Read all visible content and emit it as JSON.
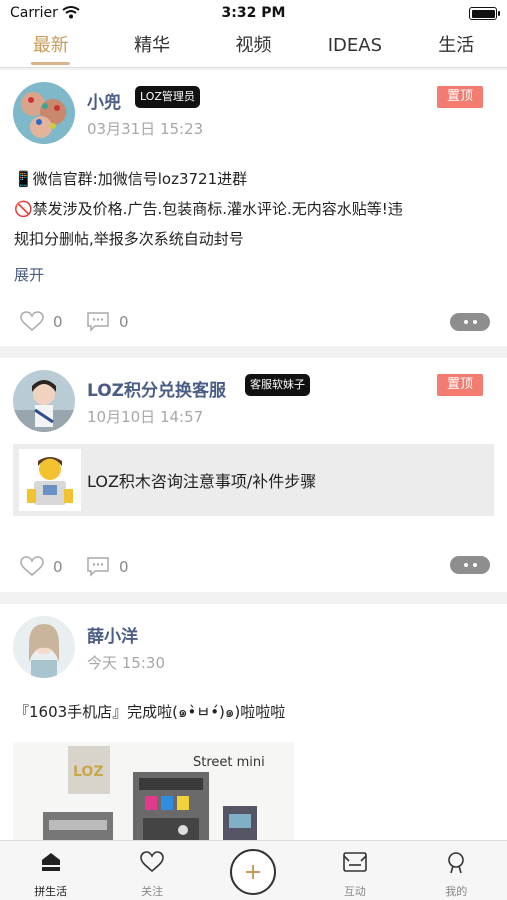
{
  "status_bar": {
    "carrier": "Carrier",
    "time": "3:32 PM",
    "battery_level": 1.0
  },
  "tabs": [
    {
      "label": "最新",
      "active": true
    },
    {
      "label": "精华",
      "active": false
    },
    {
      "label": "视频",
      "active": false
    },
    {
      "label": "IDEAS",
      "active": false
    },
    {
      "label": "生活",
      "active": false
    }
  ],
  "posts": [
    {
      "user": "小兜",
      "role_badge": "LOZ管理员",
      "pinned_label": "置顶",
      "date": "03月31日 15:23",
      "lines": [
        "📱微信官群:加微信号loz3721进群",
        "🚫禁发涉及价格.广告.包装商标.灌水评论.无内容水贴等!违",
        "规扣分删帖,举报多次系统自动封号"
      ],
      "expand_label": "展开",
      "likes": "0",
      "comments": "0"
    },
    {
      "user": "LOZ积分兑换客服",
      "role_badge": "客服软妹子",
      "pinned_label": "置顶",
      "date": "10月10日 14:57",
      "link_title": "LOZ积木咨询注意事项/补件步骤",
      "likes": "0",
      "comments": "0"
    },
    {
      "user": "薛小洋",
      "date": "今天 15:30",
      "text": "『1603手机店』完成啦(๑•̀ㅂ•́)๑)啦啦啦",
      "photo_sign": "Street mini",
      "photo_logo": "LOZ"
    }
  ],
  "bottom_nav": [
    {
      "label": "拼生活",
      "icon": "home-icon",
      "active": true
    },
    {
      "label": "关注",
      "icon": "heart-icon",
      "active": false
    },
    {
      "label": "",
      "icon": "plus-icon",
      "active": false
    },
    {
      "label": "互动",
      "icon": "interaction-icon",
      "active": false
    },
    {
      "label": "我的",
      "icon": "profile-icon",
      "active": false
    }
  ],
  "colors": {
    "accent": "#c89b5a",
    "username": "#4a5d84",
    "pinned": "#f27c70"
  }
}
